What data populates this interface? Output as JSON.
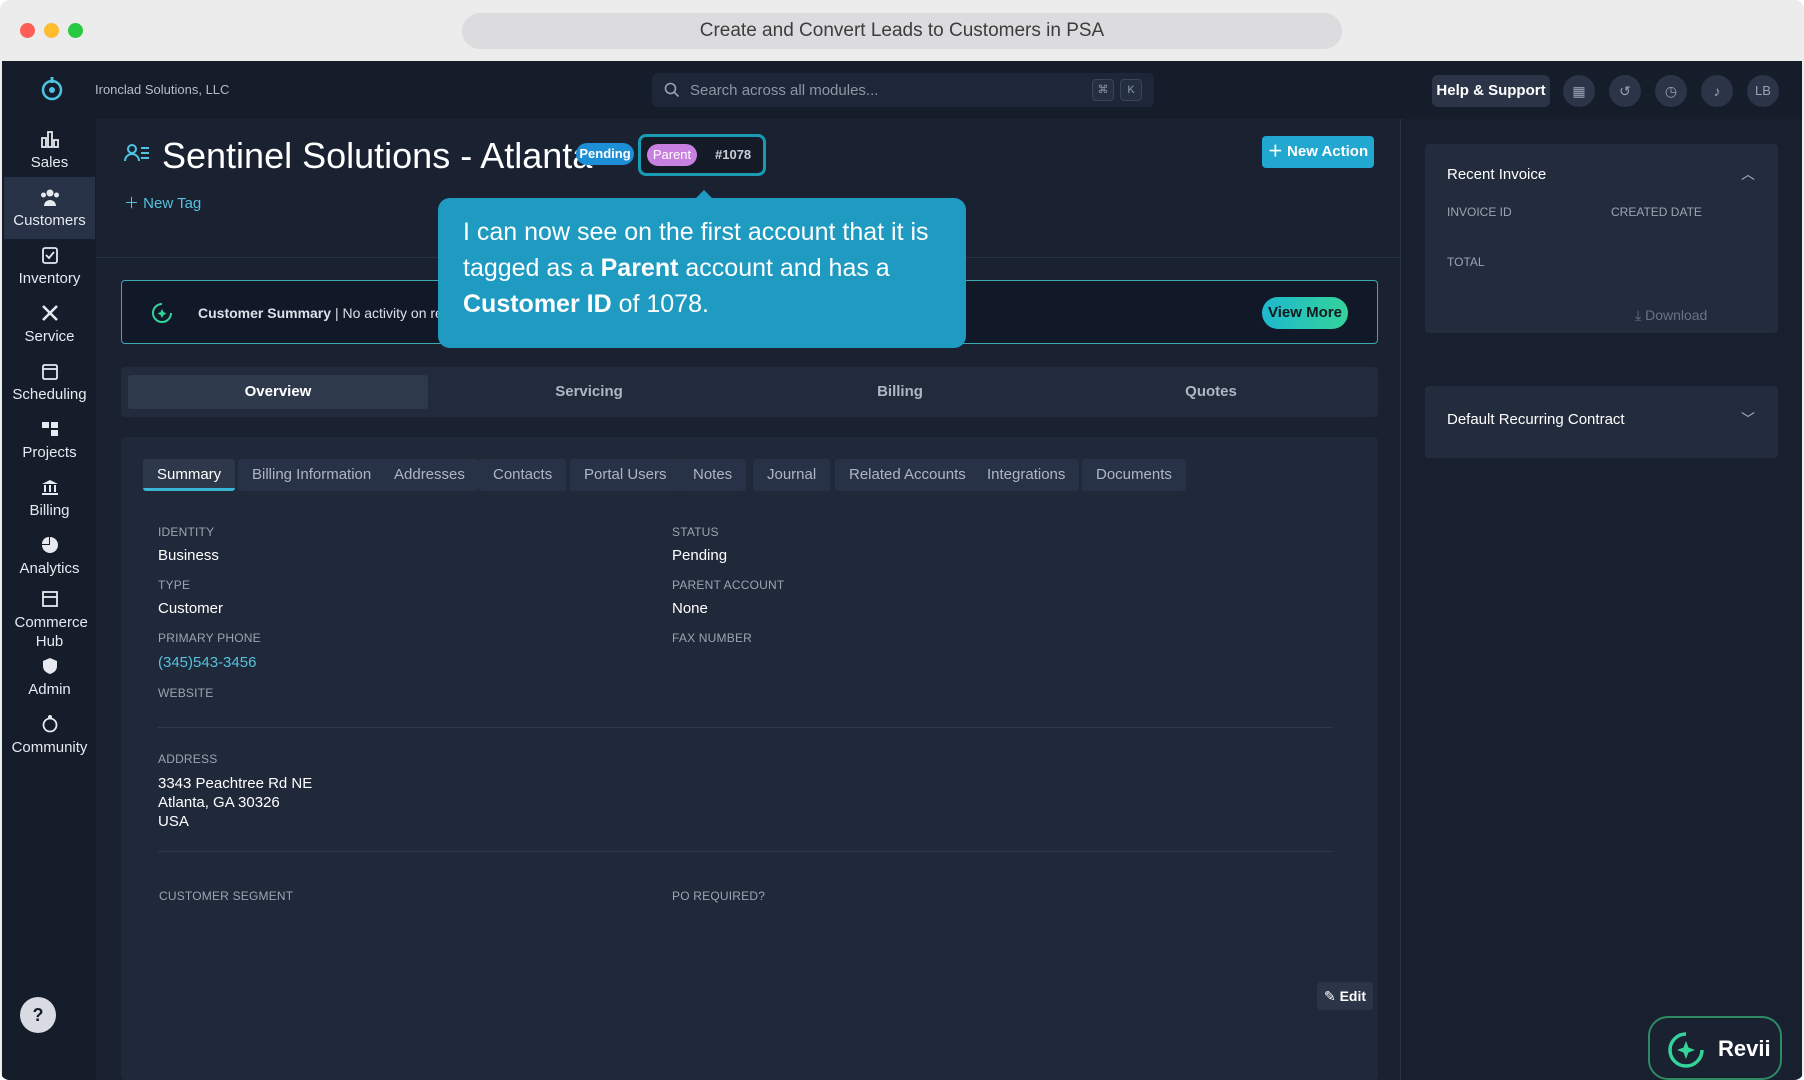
{
  "window": {
    "title": "Create and Convert Leads to Customers in PSA"
  },
  "topbar": {
    "company": "Ironclad Solutions, LLC",
    "search_placeholder": "Search across all modules...",
    "kbd_cmd": "⌘",
    "kbd_k": "K",
    "help_label": "Help & Support",
    "avatar_initials": "LB"
  },
  "sidebar": {
    "items": [
      {
        "label": "Sales",
        "icon": "sales-icon"
      },
      {
        "label": "Customers",
        "icon": "customers-icon"
      },
      {
        "label": "Inventory",
        "icon": "inventory-icon"
      },
      {
        "label": "Service",
        "icon": "service-icon"
      },
      {
        "label": "Scheduling",
        "icon": "calendar-icon"
      },
      {
        "label": "Projects",
        "icon": "projects-icon"
      },
      {
        "label": "Billing",
        "icon": "billing-icon"
      },
      {
        "label": "Analytics",
        "icon": "pie-chart-icon"
      },
      {
        "label": "Commerce Hub",
        "icon": "store-icon"
      },
      {
        "label": "Admin",
        "icon": "admin-icon"
      },
      {
        "label": "Community",
        "icon": "community-icon"
      }
    ],
    "help": "?"
  },
  "header": {
    "title": "Sentinel Solutions - Atlanta",
    "status_badge": "Pending",
    "tag_badge": "Parent",
    "customer_id": "#1078",
    "new_tag": "New Tag",
    "new_action": "New Action"
  },
  "summary": {
    "label": "Customer Summary",
    "text": "| No activity on reco",
    "view_more": "View More"
  },
  "tabs": [
    "Overview",
    "Servicing",
    "Billing",
    "Quotes"
  ],
  "subtabs": [
    "Summary",
    "Billing Information",
    "Addresses",
    "Contacts",
    "Portal Users",
    "Notes",
    "Journal",
    "Related Accounts",
    "Integrations",
    "Documents"
  ],
  "fields": {
    "identity_label": "IDENTITY",
    "identity": "Business",
    "status_label": "STATUS",
    "status": "Pending",
    "type_label": "TYPE",
    "type": "Customer",
    "parent_label": "PARENT ACCOUNT",
    "parent": "None",
    "phone_label": "PRIMARY PHONE",
    "phone": "(345)543-3456",
    "fax_label": "FAX NUMBER",
    "website_label": "WEBSITE",
    "address_label": "ADDRESS",
    "address_line1": "3343 Peachtree Rd NE",
    "address_line2": "Atlanta, GA 30326",
    "address_line3": "USA",
    "segment_label": "CUSTOMER SEGMENT",
    "po_label": "PO REQUIRED?",
    "edit": "Edit"
  },
  "right_panel": {
    "recent_invoice": "Recent Invoice",
    "invoice_id": "INVOICE ID",
    "created_date": "CREATED DATE",
    "total": "TOTAL",
    "download": "Download",
    "default_contract": "Default Recurring Contract"
  },
  "callout": {
    "part1": "I can now see on the first account that it is tagged as a ",
    "bold1": "Parent",
    "part2": " account and has a ",
    "bold2": "Customer ID",
    "part3": " of 1078."
  },
  "revii": "Revii",
  "colors": {
    "accent": "#21a7d0",
    "pending": "#1d8fd6",
    "parent": "#c77fe0",
    "callout": "#1f9bc1"
  }
}
